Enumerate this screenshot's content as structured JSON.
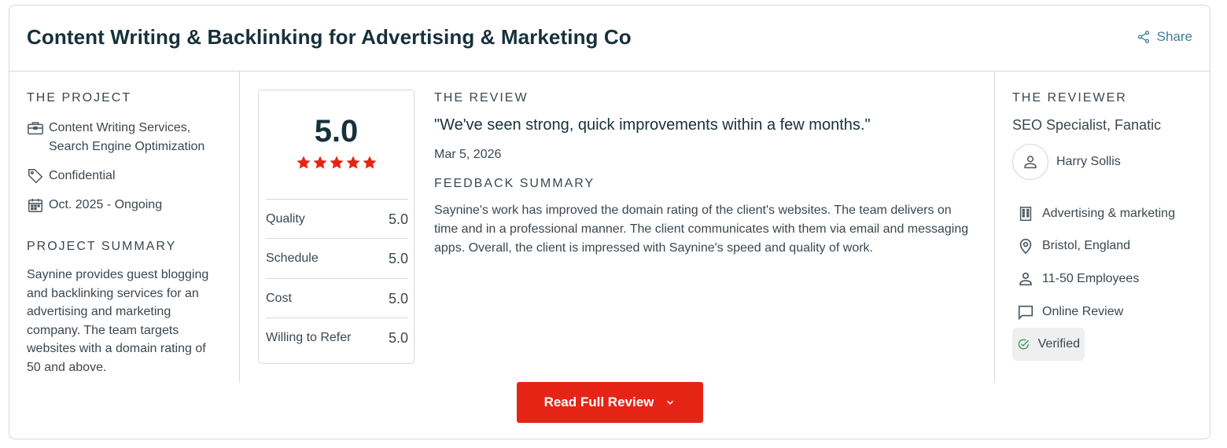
{
  "header": {
    "title": "Content Writing & Backlinking for Advertising & Marketing Co",
    "share_label": "Share"
  },
  "project": {
    "section_label": "THE PROJECT",
    "services": [
      "Content Writing Services,",
      "Search Engine Optimization"
    ],
    "budget": "Confidential",
    "timeline": "Oct. 2025 - Ongoing",
    "summary_label": "PROJECT SUMMARY",
    "summary": "Saynine provides guest blogging and backlinking services for an advertising and marketing company. The team targets websites with a domain rating of 50 and above."
  },
  "scores": {
    "overall": "5.0",
    "stars": 5,
    "star_color": "#e62415",
    "rows": [
      {
        "label": "Quality",
        "value": "5.0"
      },
      {
        "label": "Schedule",
        "value": "5.0"
      },
      {
        "label": "Cost",
        "value": "5.0"
      },
      {
        "label": "Willing to Refer",
        "value": "5.0"
      }
    ]
  },
  "review": {
    "section_label": "THE REVIEW",
    "quote": "\"We've seen strong, quick improvements within a few months.\"",
    "date": "Mar 5, 2026",
    "feedback_label": "FEEDBACK SUMMARY",
    "feedback": "Saynine's work has improved the domain rating of the client's websites. The team delivers on time and in a professional manner. The client communicates with them via email and messaging apps. Overall, the client is impressed with Saynine's speed and quality of work."
  },
  "reviewer": {
    "section_label": "THE REVIEWER",
    "role": "SEO Specialist, Fanatic",
    "name": "Harry Sollis",
    "industry": "Advertising & marketing",
    "location": "Bristol, England",
    "size": "11-50 Employees",
    "review_type": "Online Review",
    "verified": "Verified",
    "verified_color": "#2e8b57"
  },
  "actions": {
    "read_full_review": "Read Full Review",
    "button_color": "#e62415"
  }
}
